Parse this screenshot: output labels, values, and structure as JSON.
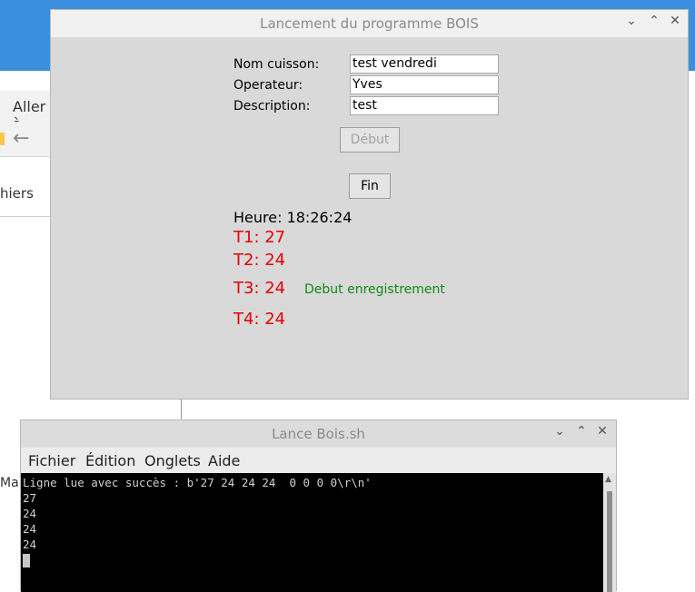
{
  "background": {
    "menu_partial": "Aller à",
    "tab_partial": "hiers",
    "side_partial": "Ma"
  },
  "dialog": {
    "title": "Lancement du programme BOIS",
    "labels": {
      "nom": "Nom cuisson:",
      "operateur": "Operateur:",
      "description": "Description:"
    },
    "fields": {
      "nom": "test vendredi",
      "operateur": "Yves",
      "description": "test"
    },
    "buttons": {
      "debut": "Début",
      "fin": "Fin"
    },
    "heure": "Heure: 18:26:24",
    "temps": {
      "t1": "T1: 27",
      "t2": "T2: 24",
      "t3": "T3: 24",
      "t4": "T4: 24"
    },
    "status": "Debut enregistrement",
    "colors": {
      "temp": "#e60000",
      "status": "#138a13"
    }
  },
  "terminal": {
    "title": "Lance Bois.sh",
    "menu": [
      "Fichier",
      "Édition",
      "Onglets",
      "Aide"
    ],
    "lines": [
      "Ligne lue avec succès : b'27 24 24 24  0 0 0 0\\r\\n'",
      "27",
      "24",
      "24",
      "24"
    ]
  }
}
